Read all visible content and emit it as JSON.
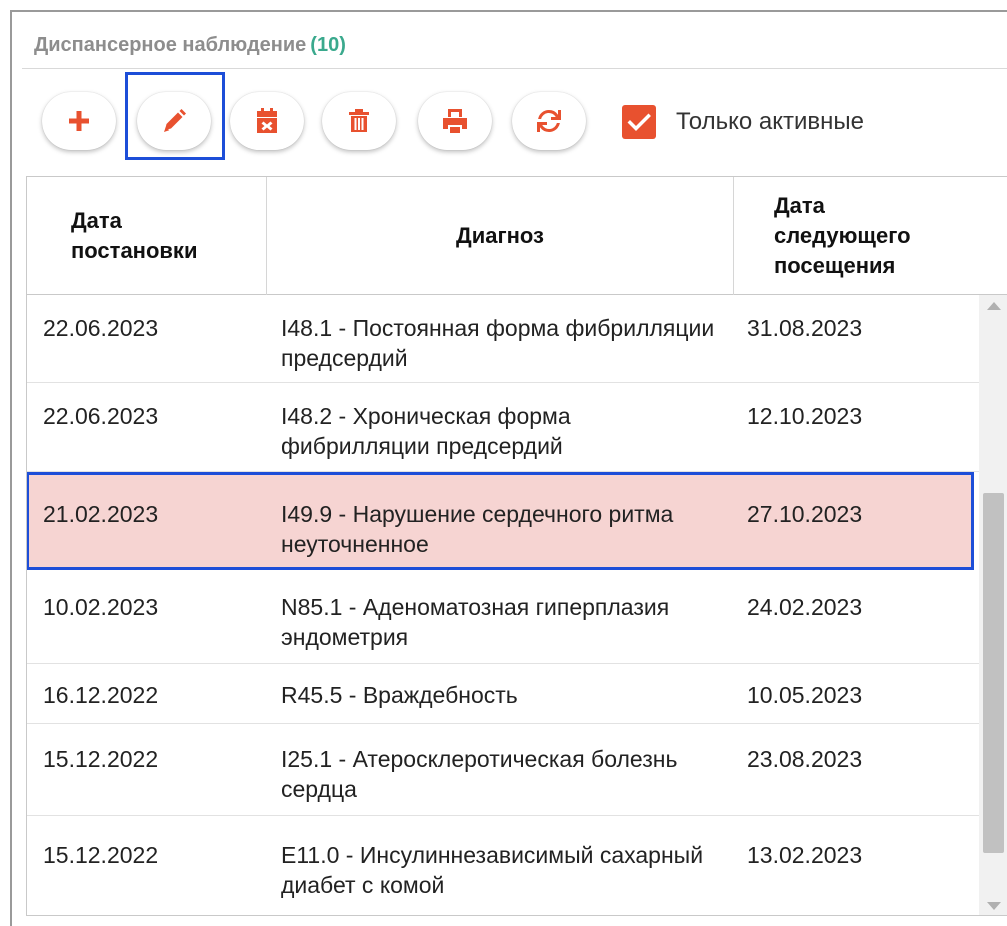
{
  "panel": {
    "title": "Диспансерное наблюдение",
    "count": "(10)"
  },
  "toolbar": {
    "buttons": [
      {
        "name": "add",
        "icon": "plus-icon"
      },
      {
        "name": "edit",
        "icon": "pencil-icon"
      },
      {
        "name": "remove-date",
        "icon": "calendar-x-icon"
      },
      {
        "name": "delete",
        "icon": "trash-icon"
      },
      {
        "name": "print",
        "icon": "printer-icon"
      },
      {
        "name": "refresh",
        "icon": "refresh-icon"
      }
    ],
    "active_only": {
      "label": "Только активные",
      "checked": true
    }
  },
  "colors": {
    "accent": "#e8512f",
    "count": "#3aa98d",
    "selection_border": "#1d4ed8",
    "selected_row": "#f6d4d2"
  },
  "table": {
    "headers": {
      "registration_date": "Дата постановки",
      "diagnosis": "Диагноз",
      "next_visit_date": "Дата следующего посещения"
    },
    "rows": [
      {
        "registration_date": "22.06.2023",
        "diagnosis": "I48.1 - Постоянная форма фибрилляции предсердий",
        "next_visit_date": "31.08.2023"
      },
      {
        "registration_date": "22.06.2023",
        "diagnosis": "I48.2 - Хроническая форма фибрилляции предсердий",
        "next_visit_date": "12.10.2023"
      },
      {
        "registration_date": "21.02.2023",
        "diagnosis": "I49.9 - Нарушение сердечного ритма неуточненное",
        "next_visit_date": "27.10.2023"
      },
      {
        "registration_date": "10.02.2023",
        "diagnosis": "N85.1 - Аденоматозная гиперплазия эндометрия",
        "next_visit_date": "24.02.2023"
      },
      {
        "registration_date": "16.12.2022",
        "diagnosis": "R45.5 - Враждебность",
        "next_visit_date": "10.05.2023"
      },
      {
        "registration_date": "15.12.2022",
        "diagnosis": "I25.1 - Атеросклеротическая болезнь сердца",
        "next_visit_date": "23.08.2023"
      },
      {
        "registration_date": "15.12.2022",
        "diagnosis": "E11.0 - Инсулиннезависимый сахарный диабет с комой",
        "next_visit_date": "13.02.2023"
      }
    ]
  }
}
